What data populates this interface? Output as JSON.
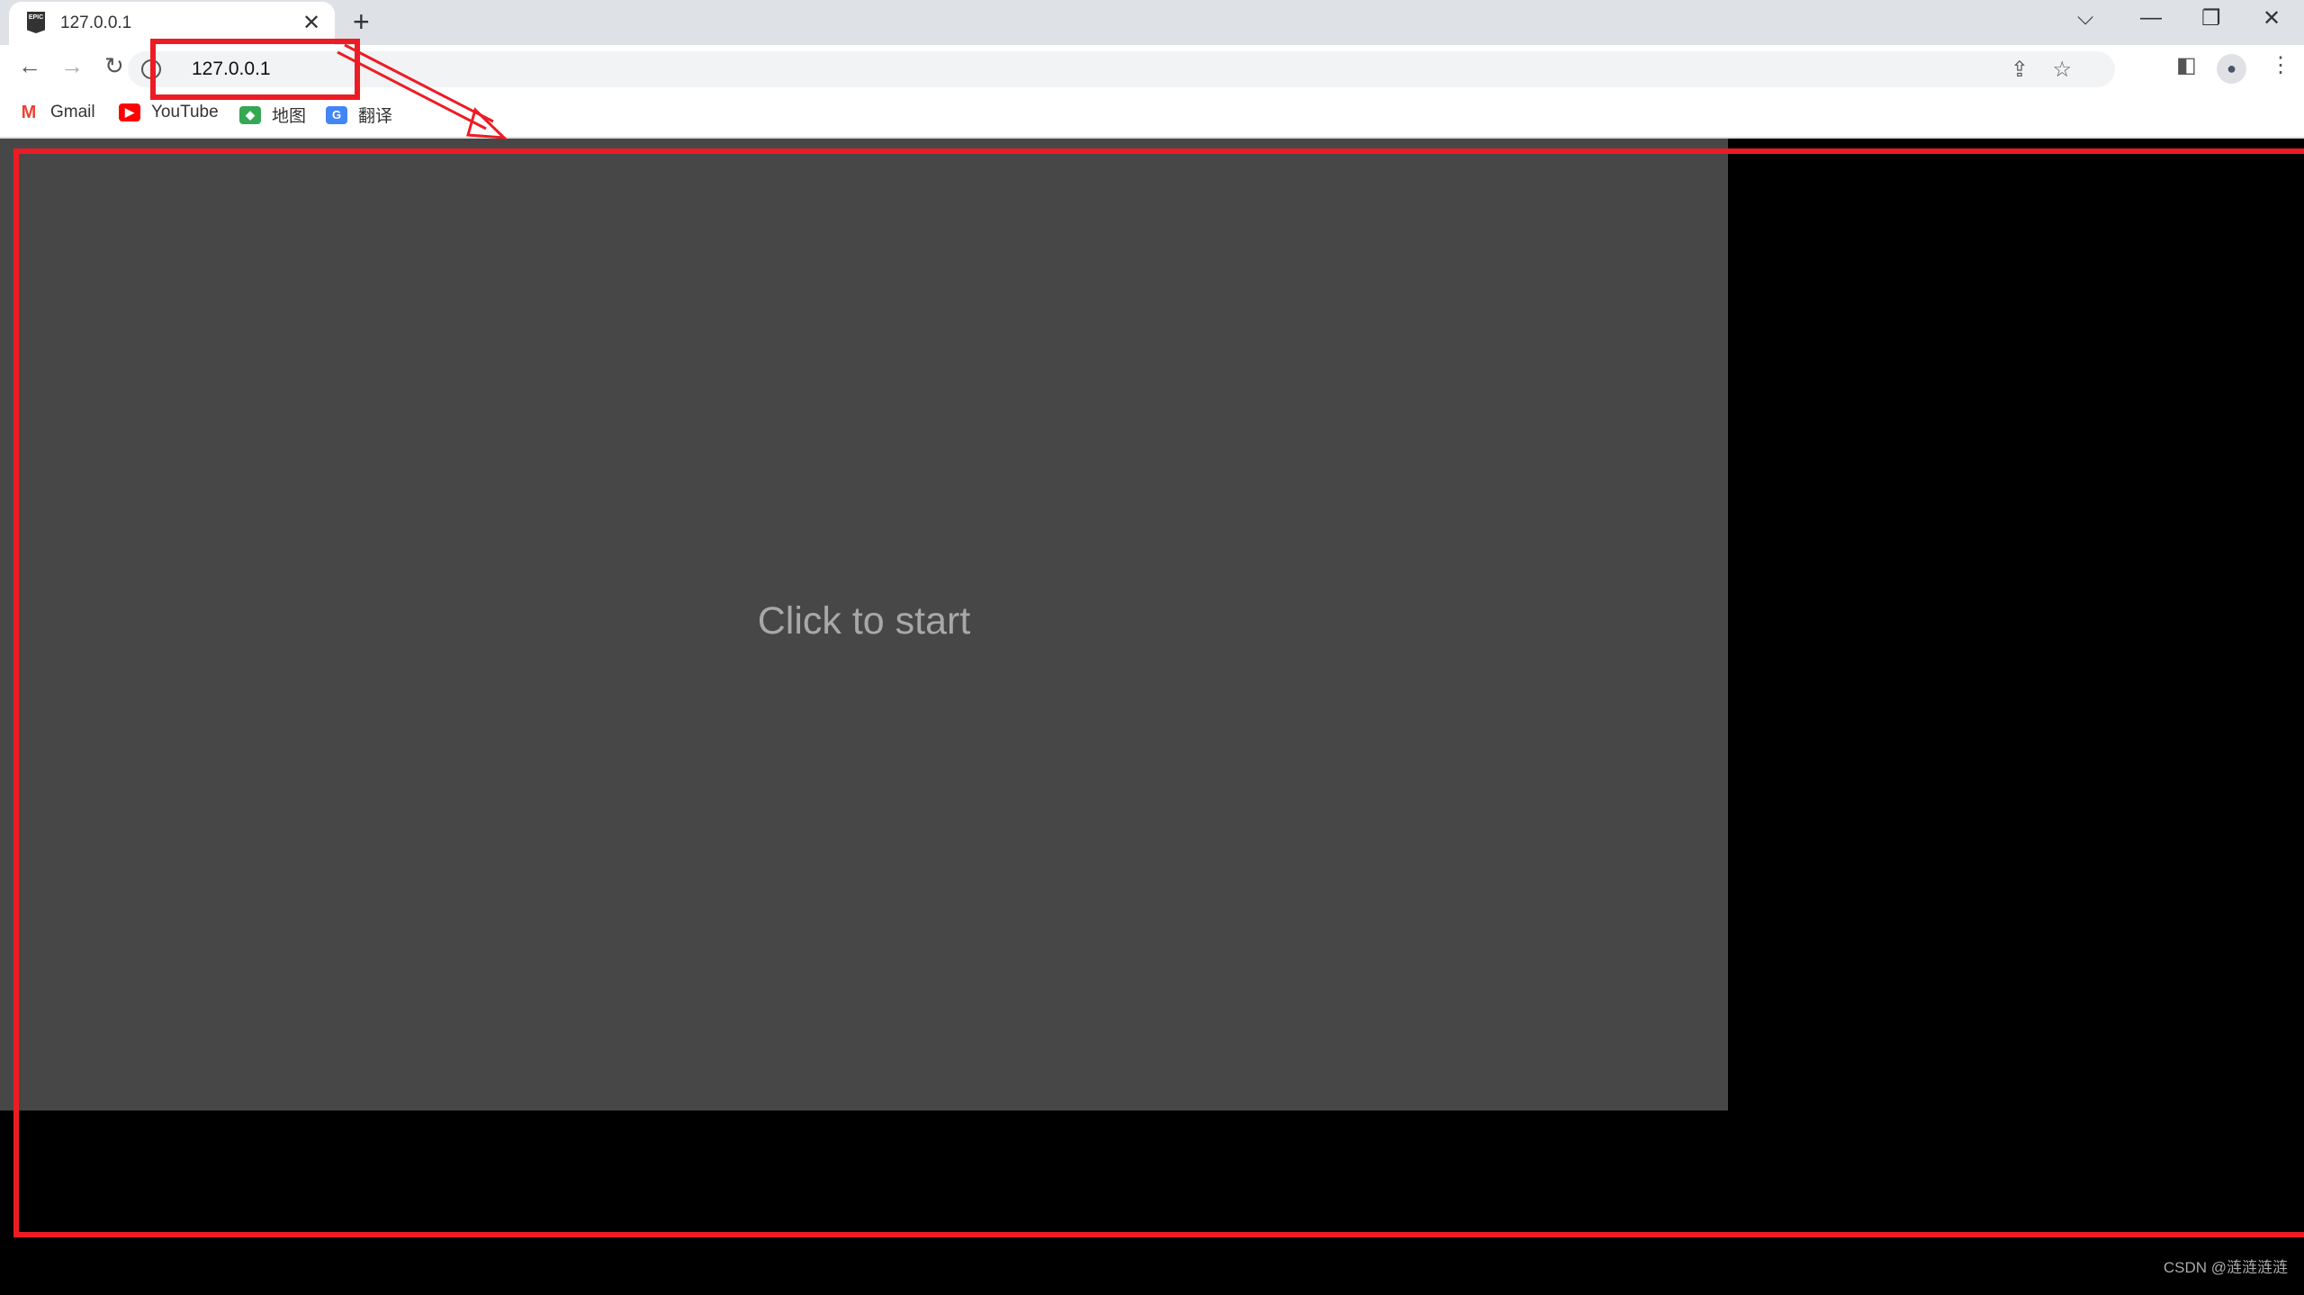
{
  "browser": {
    "tab": {
      "title": "127.0.0.1",
      "favicon_text": "EPIC"
    },
    "address": "127.0.0.1",
    "bookmarks": [
      {
        "label": "Gmail",
        "icon": "gmail-icon",
        "color": "#ea4335"
      },
      {
        "label": "YouTube",
        "icon": "youtube-icon",
        "color": "#ff0000"
      },
      {
        "label": "地图",
        "icon": "maps-icon",
        "color": "#34a853"
      },
      {
        "label": "翻译",
        "icon": "translate-icon",
        "color": "#4285f4"
      }
    ]
  },
  "game": {
    "prompt": "Click to start",
    "background": "#474747"
  },
  "annotation": {
    "color": "#ed1c24"
  },
  "watermark": "CSDN @涟涟涟涟"
}
